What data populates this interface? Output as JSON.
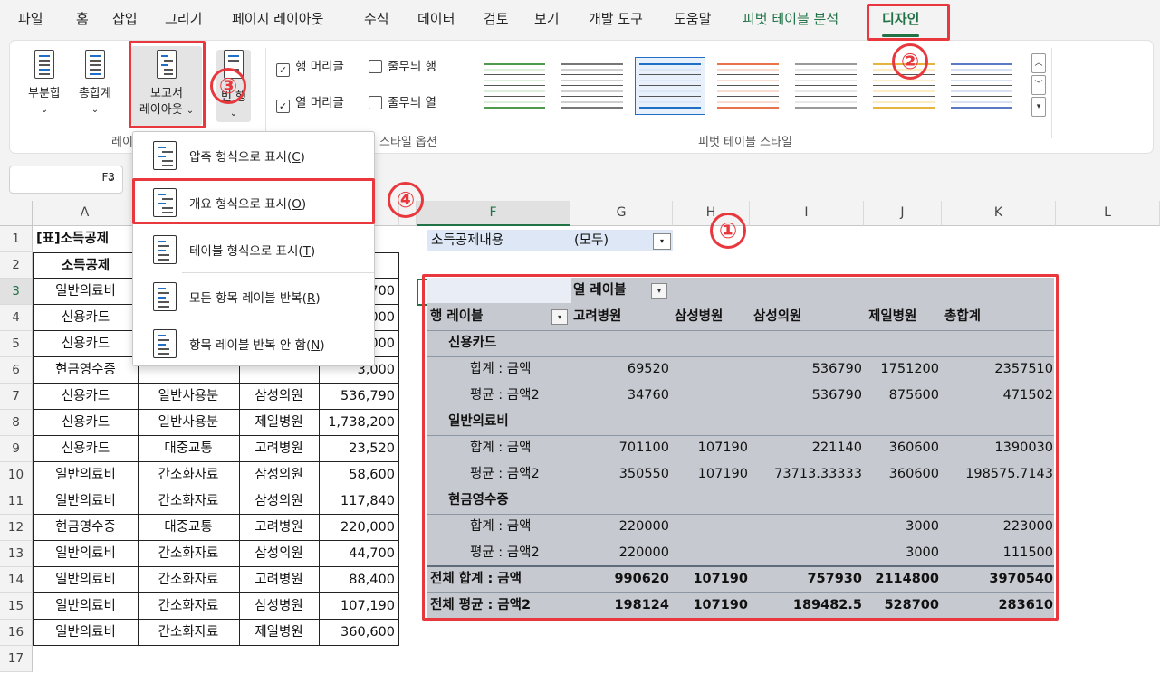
{
  "tabs": [
    "파일",
    "홈",
    "삽입",
    "그리기",
    "페이지 레이아웃",
    "수식",
    "데이터",
    "검토",
    "보기",
    "개발 도구",
    "도움말",
    "피벗 테이블 분석",
    "디자인"
  ],
  "ribbon": {
    "subtotals": "부분합",
    "grand_totals": "총합계",
    "report_layout_1": "보고서",
    "report_layout_2": "레이아웃",
    "blank_rows_partial": "빈 행",
    "group_layout_partial": "레이",
    "group_style_options_partial": "스타일 옵션",
    "group_pivot_styles": "피벗 테이블 스타일",
    "checkboxes": [
      {
        "label": "행 머리글",
        "checked": true
      },
      {
        "label": "줄무늬 행",
        "checked": false
      },
      {
        "label": "열 머리글",
        "checked": true
      },
      {
        "label": "줄무늬 열",
        "checked": false
      }
    ]
  },
  "name_box": {
    "value": "F3"
  },
  "menu": {
    "items": [
      {
        "label": "압축 형식으로 표시",
        "key": "C"
      },
      {
        "label": "개요 형식으로 표시",
        "key": "O"
      },
      {
        "label": "테이블 형식으로 표시",
        "key": "T"
      },
      {
        "label": "모든 항목 레이블 반복",
        "key": "R"
      },
      {
        "label": "항목 레이블 반복 안 함",
        "key": "N"
      }
    ]
  },
  "columns": [
    "A",
    "",
    "",
    "",
    "",
    "F",
    "G",
    "H",
    "I",
    "J",
    "K",
    "L"
  ],
  "rows": [
    "1",
    "2",
    "3",
    "4",
    "5",
    "6",
    "7",
    "8",
    "9",
    "10",
    "11",
    "12",
    "13",
    "14",
    "15",
    "16",
    "17"
  ],
  "sheet": {
    "a1": "[표]소득공제",
    "a2": "소득공제",
    "table_rows": [
      {
        "a": "일반의료비",
        "b": "",
        "c": "",
        "d": "700"
      },
      {
        "a": "신용카드",
        "b": "",
        "c": "",
        "d": "000"
      },
      {
        "a": "신용카드",
        "b": "",
        "c": "",
        "d": "000"
      },
      {
        "a": "현금영수증",
        "b": "",
        "c": "",
        "d": "3,000"
      },
      {
        "a": "신용카드",
        "b": "일반사용분",
        "c": "삼성의원",
        "d": "536,790"
      },
      {
        "a": "신용카드",
        "b": "일반사용분",
        "c": "제일병원",
        "d": "1,738,200"
      },
      {
        "a": "신용카드",
        "b": "대중교통",
        "c": "고려병원",
        "d": "23,520"
      },
      {
        "a": "일반의료비",
        "b": "간소화자료",
        "c": "삼성의원",
        "d": "58,600"
      },
      {
        "a": "일반의료비",
        "b": "간소화자료",
        "c": "삼성의원",
        "d": "117,840"
      },
      {
        "a": "현금영수증",
        "b": "대중교통",
        "c": "고려병원",
        "d": "220,000"
      },
      {
        "a": "일반의료비",
        "b": "간소화자료",
        "c": "삼성의원",
        "d": "44,700"
      },
      {
        "a": "일반의료비",
        "b": "간소화자료",
        "c": "고려병원",
        "d": "88,400"
      },
      {
        "a": "일반의료비",
        "b": "간소화자료",
        "c": "삼성병원",
        "d": "107,190"
      },
      {
        "a": "일반의료비",
        "b": "간소화자료",
        "c": "제일병원",
        "d": "360,600"
      }
    ]
  },
  "pivot": {
    "filter_label": "소득공제내용",
    "filter_value": "(모두)",
    "col_label": "열 레이블",
    "row_label": "행 레이블",
    "headers": [
      "고려병원",
      "삼성병원",
      "삼성의원",
      "제일병원",
      "총합계"
    ],
    "rows": [
      {
        "label": "신용카드",
        "type": "group",
        "vals": [
          "",
          "",
          "",
          "",
          ""
        ]
      },
      {
        "label": "합계 : 금액",
        "type": "item",
        "vals": [
          "69520",
          "",
          "536790",
          "1751200",
          "2357510"
        ]
      },
      {
        "label": "평균 : 금액2",
        "type": "item",
        "vals": [
          "34760",
          "",
          "536790",
          "875600",
          "471502"
        ]
      },
      {
        "label": "일반의료비",
        "type": "group",
        "vals": [
          "",
          "",
          "",
          "",
          ""
        ]
      },
      {
        "label": "합계 : 금액",
        "type": "item",
        "vals": [
          "701100",
          "107190",
          "221140",
          "360600",
          "1390030"
        ]
      },
      {
        "label": "평균 : 금액2",
        "type": "item",
        "vals": [
          "350550",
          "107190",
          "73713.33333",
          "360600",
          "198575.7143"
        ]
      },
      {
        "label": "현금영수증",
        "type": "group",
        "vals": [
          "",
          "",
          "",
          "",
          ""
        ]
      },
      {
        "label": "합계 : 금액",
        "type": "item",
        "vals": [
          "220000",
          "",
          "",
          "3000",
          "223000"
        ]
      },
      {
        "label": "평균 : 금액2",
        "type": "item",
        "vals": [
          "220000",
          "",
          "",
          "3000",
          "111500"
        ]
      },
      {
        "label": "전체 합계 : 금액",
        "type": "total",
        "vals": [
          "990620",
          "107190",
          "757930",
          "2114800",
          "3970540"
        ]
      },
      {
        "label": "전체 평균 : 금액2",
        "type": "total",
        "vals": [
          "198124",
          "107190",
          "189482.5",
          "528700",
          "283610"
        ]
      }
    ]
  },
  "callouts": [
    "①",
    "②",
    "③",
    "④"
  ],
  "colors": {
    "accent": "#217346",
    "highlight": "#e8383d",
    "pivot_bg": "#c6c9cf",
    "filter_bg": "#dde7f5"
  }
}
